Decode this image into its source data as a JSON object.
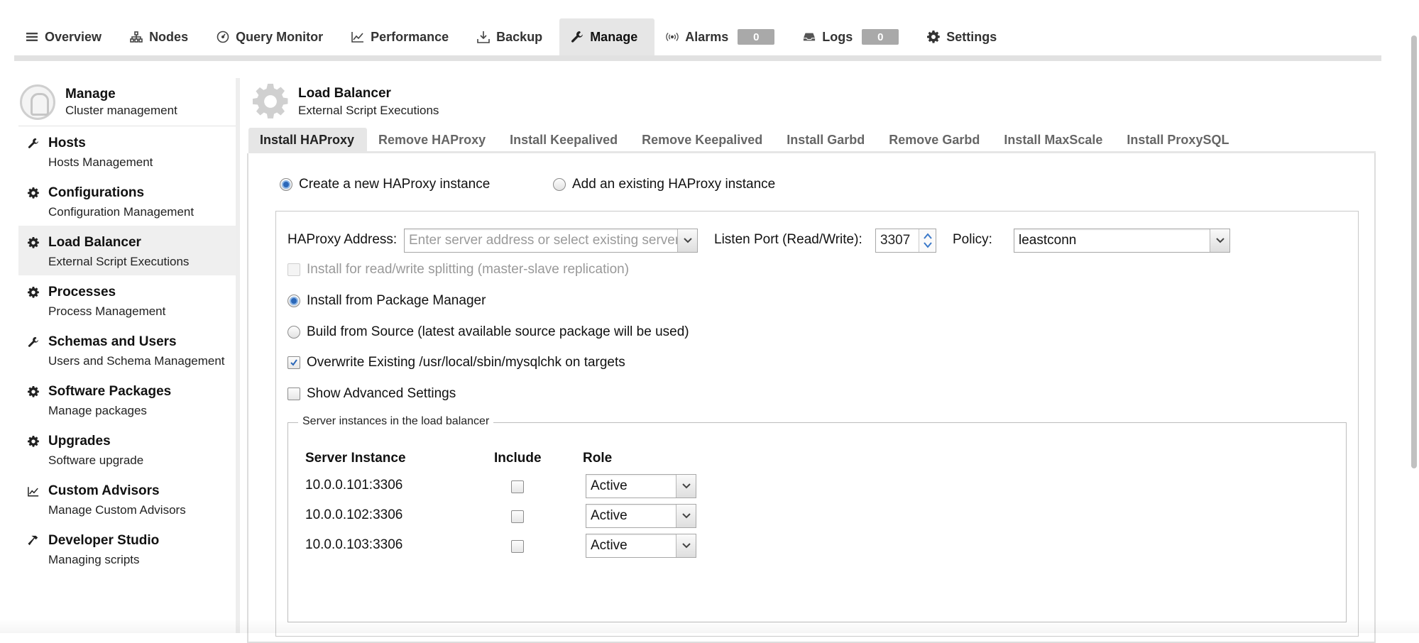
{
  "topnav": {
    "items": [
      {
        "label": "Overview",
        "icon": "list-icon"
      },
      {
        "label": "Nodes",
        "icon": "sitemap-icon"
      },
      {
        "label": "Query Monitor",
        "icon": "gauge-icon"
      },
      {
        "label": "Performance",
        "icon": "line-chart-icon"
      },
      {
        "label": "Backup",
        "icon": "download-icon"
      },
      {
        "label": "Manage",
        "icon": "wrench-icon",
        "active": true
      },
      {
        "label": "Alarms",
        "icon": "broadcast-icon",
        "badge": "0"
      },
      {
        "label": "Logs",
        "icon": "inbox-icon",
        "badge": "0"
      },
      {
        "label": "Settings",
        "icon": "gear-icon"
      }
    ]
  },
  "sidebar": {
    "header": {
      "title": "Manage",
      "subtitle": "Cluster management"
    },
    "items": [
      {
        "title": "Hosts",
        "subtitle": "Hosts Management",
        "icon": "wrench-icon"
      },
      {
        "title": "Configurations",
        "subtitle": "Configuration Management",
        "icon": "gear-icon"
      },
      {
        "title": "Load Balancer",
        "subtitle": "External Script Executions",
        "icon": "gear-icon",
        "active": true
      },
      {
        "title": "Processes",
        "subtitle": "Process Management",
        "icon": "gear-icon"
      },
      {
        "title": "Schemas and Users",
        "subtitle": "Users and Schema Management",
        "icon": "wrench-icon"
      },
      {
        "title": "Software Packages",
        "subtitle": "Manage packages",
        "icon": "gear-icon"
      },
      {
        "title": "Upgrades",
        "subtitle": "Software upgrade",
        "icon": "gear-icon"
      },
      {
        "title": "Custom Advisors",
        "subtitle": "Manage Custom Advisors",
        "icon": "line-chart-icon"
      },
      {
        "title": "Developer Studio",
        "subtitle": "Managing scripts",
        "icon": "hammer-icon"
      }
    ]
  },
  "main": {
    "title": "Load Balancer",
    "subtitle": "External Script Executions",
    "tabs": [
      {
        "label": "Install HAProxy",
        "active": true
      },
      {
        "label": "Remove HAProxy"
      },
      {
        "label": "Install Keepalived"
      },
      {
        "label": "Remove Keepalived"
      },
      {
        "label": "Install Garbd"
      },
      {
        "label": "Remove Garbd"
      },
      {
        "label": "Install MaxScale"
      },
      {
        "label": "Install ProxySQL"
      }
    ]
  },
  "form": {
    "mode_create": "Create a new HAProxy instance",
    "mode_existing": "Add an existing HAProxy instance",
    "mode_selected": "create",
    "address_label": "HAProxy Address:",
    "address_placeholder": "Enter server address or select existing server",
    "port_label": "Listen Port (Read/Write):",
    "port_value": "3307",
    "policy_label": "Policy:",
    "policy_value": "leastconn",
    "rw_split_label": "Install for read/write splitting (master-slave replication)",
    "install_pkg_label": "Install from Package Manager",
    "build_source_label": "Build from Source (latest available source package will be used)",
    "install_source_selected": "package",
    "overwrite_label": "Overwrite Existing /usr/local/sbin/mysqlchk on targets",
    "overwrite_checked": true,
    "advanced_label": "Show Advanced Settings",
    "advanced_checked": false
  },
  "servers": {
    "legend": "Server instances in the load balancer",
    "headers": {
      "instance": "Server Instance",
      "include": "Include",
      "role": "Role"
    },
    "rows": [
      {
        "instance": "10.0.0.101:3306",
        "include": false,
        "role": "Active"
      },
      {
        "instance": "10.0.0.102:3306",
        "include": false,
        "role": "Active"
      },
      {
        "instance": "10.0.0.103:3306",
        "include": false,
        "role": "Active"
      }
    ]
  },
  "colors": {
    "accent": "#2b67b8",
    "tab_active_bg": "#e6e6e6",
    "badge_bg": "#a9a9a9"
  }
}
